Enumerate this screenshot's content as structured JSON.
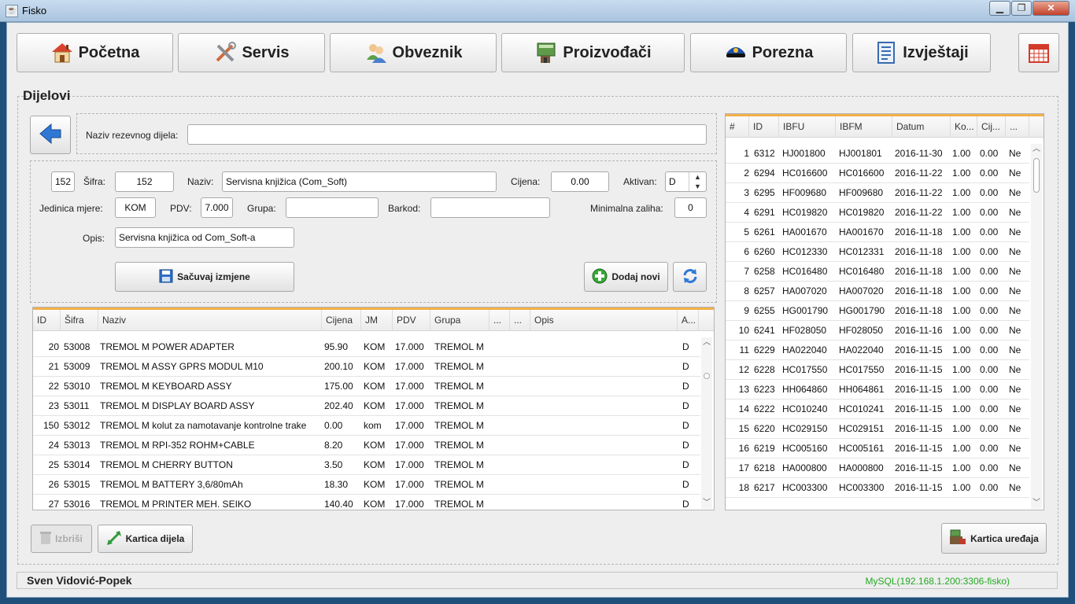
{
  "window": {
    "title": "Fisko",
    "minimize": "▁",
    "maximize": "❐",
    "close": "✕"
  },
  "nav": [
    {
      "label": "Početna",
      "icon": "house-icon"
    },
    {
      "label": "Servis",
      "icon": "tools-icon"
    },
    {
      "label": "Obveznik",
      "icon": "users-icon"
    },
    {
      "label": "Proizvođači",
      "icon": "factory-icon"
    },
    {
      "label": "Porezna",
      "icon": "police-cap-icon"
    },
    {
      "label": "Izvještaji",
      "icon": "report-icon"
    }
  ],
  "section_title": "Dijelovi",
  "search": {
    "label": "Naziv rezevnog dijela:",
    "value": ""
  },
  "form": {
    "id_value": "152",
    "sifra_label": "Šifra:",
    "sifra_value": "152",
    "naziv_label": "Naziv:",
    "naziv_value": "Servisna knjižica (Com_Soft)",
    "cijena_label": "Cijena:",
    "cijena_value": "0.00",
    "aktivan_label": "Aktivan:",
    "aktivan_value": "D",
    "jm_label": "Jedinica mjere:",
    "jm_value": "KOM",
    "pdv_label": "PDV:",
    "pdv_value": "7.000",
    "grupa_label": "Grupa:",
    "grupa_value": "",
    "barkod_label": "Barkod:",
    "barkod_value": "",
    "minzal_label": "Minimalna zaliha:",
    "minzal_value": "0",
    "opis_label": "Opis:",
    "opis_value": "Servisna knjižica od Com_Soft-a",
    "save_label": "Sačuvaj izmjene",
    "add_label": "Dodaj novi"
  },
  "parts_table": {
    "columns": [
      "ID",
      "Šifra",
      "Naziv",
      "Cijena",
      "JM",
      "PDV",
      "Grupa",
      "...",
      "...",
      "Opis",
      "A..."
    ],
    "rows": [
      [
        "20",
        "53008",
        "TREMOL M POWER ADAPTER",
        "95.90",
        "KOM",
        "17.000",
        "TREMOL M",
        "D"
      ],
      [
        "21",
        "53009",
        "TREMOL M ASSY GPRS MODUL M10",
        "200.10",
        "KOM",
        "17.000",
        "TREMOL M",
        "D"
      ],
      [
        "22",
        "53010",
        "TREMOL M KEYBOARD ASSY",
        "175.00",
        "KOM",
        "17.000",
        "TREMOL M",
        "D"
      ],
      [
        "23",
        "53011",
        "TREMOL M DISPLAY BOARD ASSY",
        "202.40",
        "KOM",
        "17.000",
        "TREMOL M",
        "D"
      ],
      [
        "150",
        "53012",
        "TREMOL M kolut za namotavanje kontrolne trake",
        "0.00",
        "kom",
        "17.000",
        "TREMOL M",
        "D"
      ],
      [
        "24",
        "53013",
        "TREMOL M RPI-352 ROHM+CABLE",
        "8.20",
        "KOM",
        "17.000",
        "TREMOL M",
        "D"
      ],
      [
        "25",
        "53014",
        "TREMOL M CHERRY BUTTON",
        "3.50",
        "KOM",
        "17.000",
        "TREMOL M",
        "D"
      ],
      [
        "26",
        "53015",
        "TREMOL M BATTERY 3,6/80mAh",
        "18.30",
        "KOM",
        "17.000",
        "TREMOL M",
        "D"
      ],
      [
        "27",
        "53016",
        "TREMOL M PRINTER MEH. SEIKO",
        "140.40",
        "KOM",
        "17.000",
        "TREMOL M",
        "D"
      ]
    ]
  },
  "devices_table": {
    "columns": [
      "#",
      "ID",
      "IBFU",
      "IBFM",
      "Datum",
      "Ko...",
      "Cij...",
      "..."
    ],
    "rows": [
      [
        "1",
        "6312",
        "HJ001800",
        "HJ001801",
        "2016-11-30",
        "1.00",
        "0.00",
        "Ne"
      ],
      [
        "2",
        "6294",
        "HC016600",
        "HC016600",
        "2016-11-22",
        "1.00",
        "0.00",
        "Ne"
      ],
      [
        "3",
        "6295",
        "HF009680",
        "HF009680",
        "2016-11-22",
        "1.00",
        "0.00",
        "Ne"
      ],
      [
        "4",
        "6291",
        "HC019820",
        "HC019820",
        "2016-11-22",
        "1.00",
        "0.00",
        "Ne"
      ],
      [
        "5",
        "6261",
        "HA001670",
        "HA001670",
        "2016-11-18",
        "1.00",
        "0.00",
        "Ne"
      ],
      [
        "6",
        "6260",
        "HC012330",
        "HC012331",
        "2016-11-18",
        "1.00",
        "0.00",
        "Ne"
      ],
      [
        "7",
        "6258",
        "HC016480",
        "HC016480",
        "2016-11-18",
        "1.00",
        "0.00",
        "Ne"
      ],
      [
        "8",
        "6257",
        "HA007020",
        "HA007020",
        "2016-11-18",
        "1.00",
        "0.00",
        "Ne"
      ],
      [
        "9",
        "6255",
        "HG001790",
        "HG001790",
        "2016-11-18",
        "1.00",
        "0.00",
        "Ne"
      ],
      [
        "10",
        "6241",
        "HF028050",
        "HF028050",
        "2016-11-16",
        "1.00",
        "0.00",
        "Ne"
      ],
      [
        "11",
        "6229",
        "HA022040",
        "HA022040",
        "2016-11-15",
        "1.00",
        "0.00",
        "Ne"
      ],
      [
        "12",
        "6228",
        "HC017550",
        "HC017550",
        "2016-11-15",
        "1.00",
        "0.00",
        "Ne"
      ],
      [
        "13",
        "6223",
        "HH064860",
        "HH064861",
        "2016-11-15",
        "1.00",
        "0.00",
        "Ne"
      ],
      [
        "14",
        "6222",
        "HC010240",
        "HC010241",
        "2016-11-15",
        "1.00",
        "0.00",
        "Ne"
      ],
      [
        "15",
        "6220",
        "HC029150",
        "HC029151",
        "2016-11-15",
        "1.00",
        "0.00",
        "Ne"
      ],
      [
        "16",
        "6219",
        "HC005160",
        "HC005161",
        "2016-11-15",
        "1.00",
        "0.00",
        "Ne"
      ],
      [
        "17",
        "6218",
        "HA000800",
        "HA000800",
        "2016-11-15",
        "1.00",
        "0.00",
        "Ne"
      ],
      [
        "18",
        "6217",
        "HC003300",
        "HC003300",
        "2016-11-15",
        "1.00",
        "0.00",
        "Ne"
      ]
    ]
  },
  "bottom": {
    "delete_label": "Izbriši",
    "part_card_label": "Kartica dijela",
    "device_card_label": "Kartica uređaja"
  },
  "status": {
    "user": "Sven Vidović-Popek",
    "db": "MySQL(192.168.1.200:3306-fisko)",
    "db_color": "#22aa22"
  },
  "colors": {
    "accent": "#f2b049",
    "titlebar": "#b7cde4"
  }
}
